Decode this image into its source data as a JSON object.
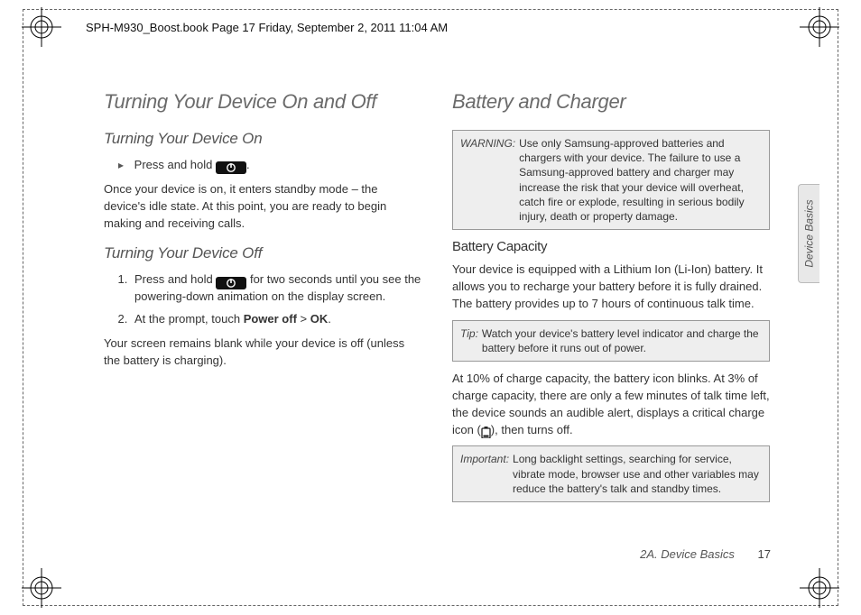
{
  "header": {
    "running_head": "SPH-M930_Boost.book  Page 17  Friday, September 2, 2011  11:04 AM"
  },
  "side_tab": {
    "label": "Device Basics"
  },
  "left": {
    "h1": "Turning Your Device On and Off",
    "h2a": "Turning Your Device On",
    "step_on_pre": "Press and hold ",
    "step_on_post": ".",
    "p_on": "Once your device is on, it enters standby mode – the device's idle state. At this point, you are ready to begin making and receiving calls.",
    "h2b": "Turning Your Device Off",
    "off_step1_pre": "Press and hold ",
    "off_step1_post": " for two seconds until you see the powering-down animation on the display screen.",
    "off_step2_pre": "At the prompt, touch ",
    "off_step2_b1": "Power off",
    "off_step2_mid": " > ",
    "off_step2_b2": "OK",
    "off_step2_post": ".",
    "p_off": "Your screen remains blank while your device is off (unless the battery is charging)."
  },
  "right": {
    "h1": "Battery and Charger",
    "warn_label": "WARNING:",
    "warn_text": "Use only Samsung-approved batteries and chargers with your device. The failure to use a Samsung-approved battery and charger may increase the risk that your device will overheat, catch fire or explode, resulting in serious bodily injury, death or property damage.",
    "h3": "Battery Capacity",
    "p1": "Your device is equipped with a Lithium Ion (Li-Ion) battery. It allows you to recharge your battery before it is fully drained. The battery provides up to 7 hours of continuous talk time.",
    "tip_label": "Tip:",
    "tip_text": "Watch your device's battery level indicator and charge the battery before it runs out of power.",
    "p2_pre": "At 10% of charge capacity, the battery icon blinks. At 3% of charge capacity, there are only a few minutes of talk time left, the device sounds an audible alert, displays a critical charge icon (",
    "p2_post": "), then turns off.",
    "imp_label": "Important:",
    "imp_text": "Long backlight settings, searching for service, vibrate mode, browser use and other variables may reduce the battery's talk and standby times."
  },
  "footer": {
    "section": "2A. Device Basics",
    "page": "17"
  }
}
